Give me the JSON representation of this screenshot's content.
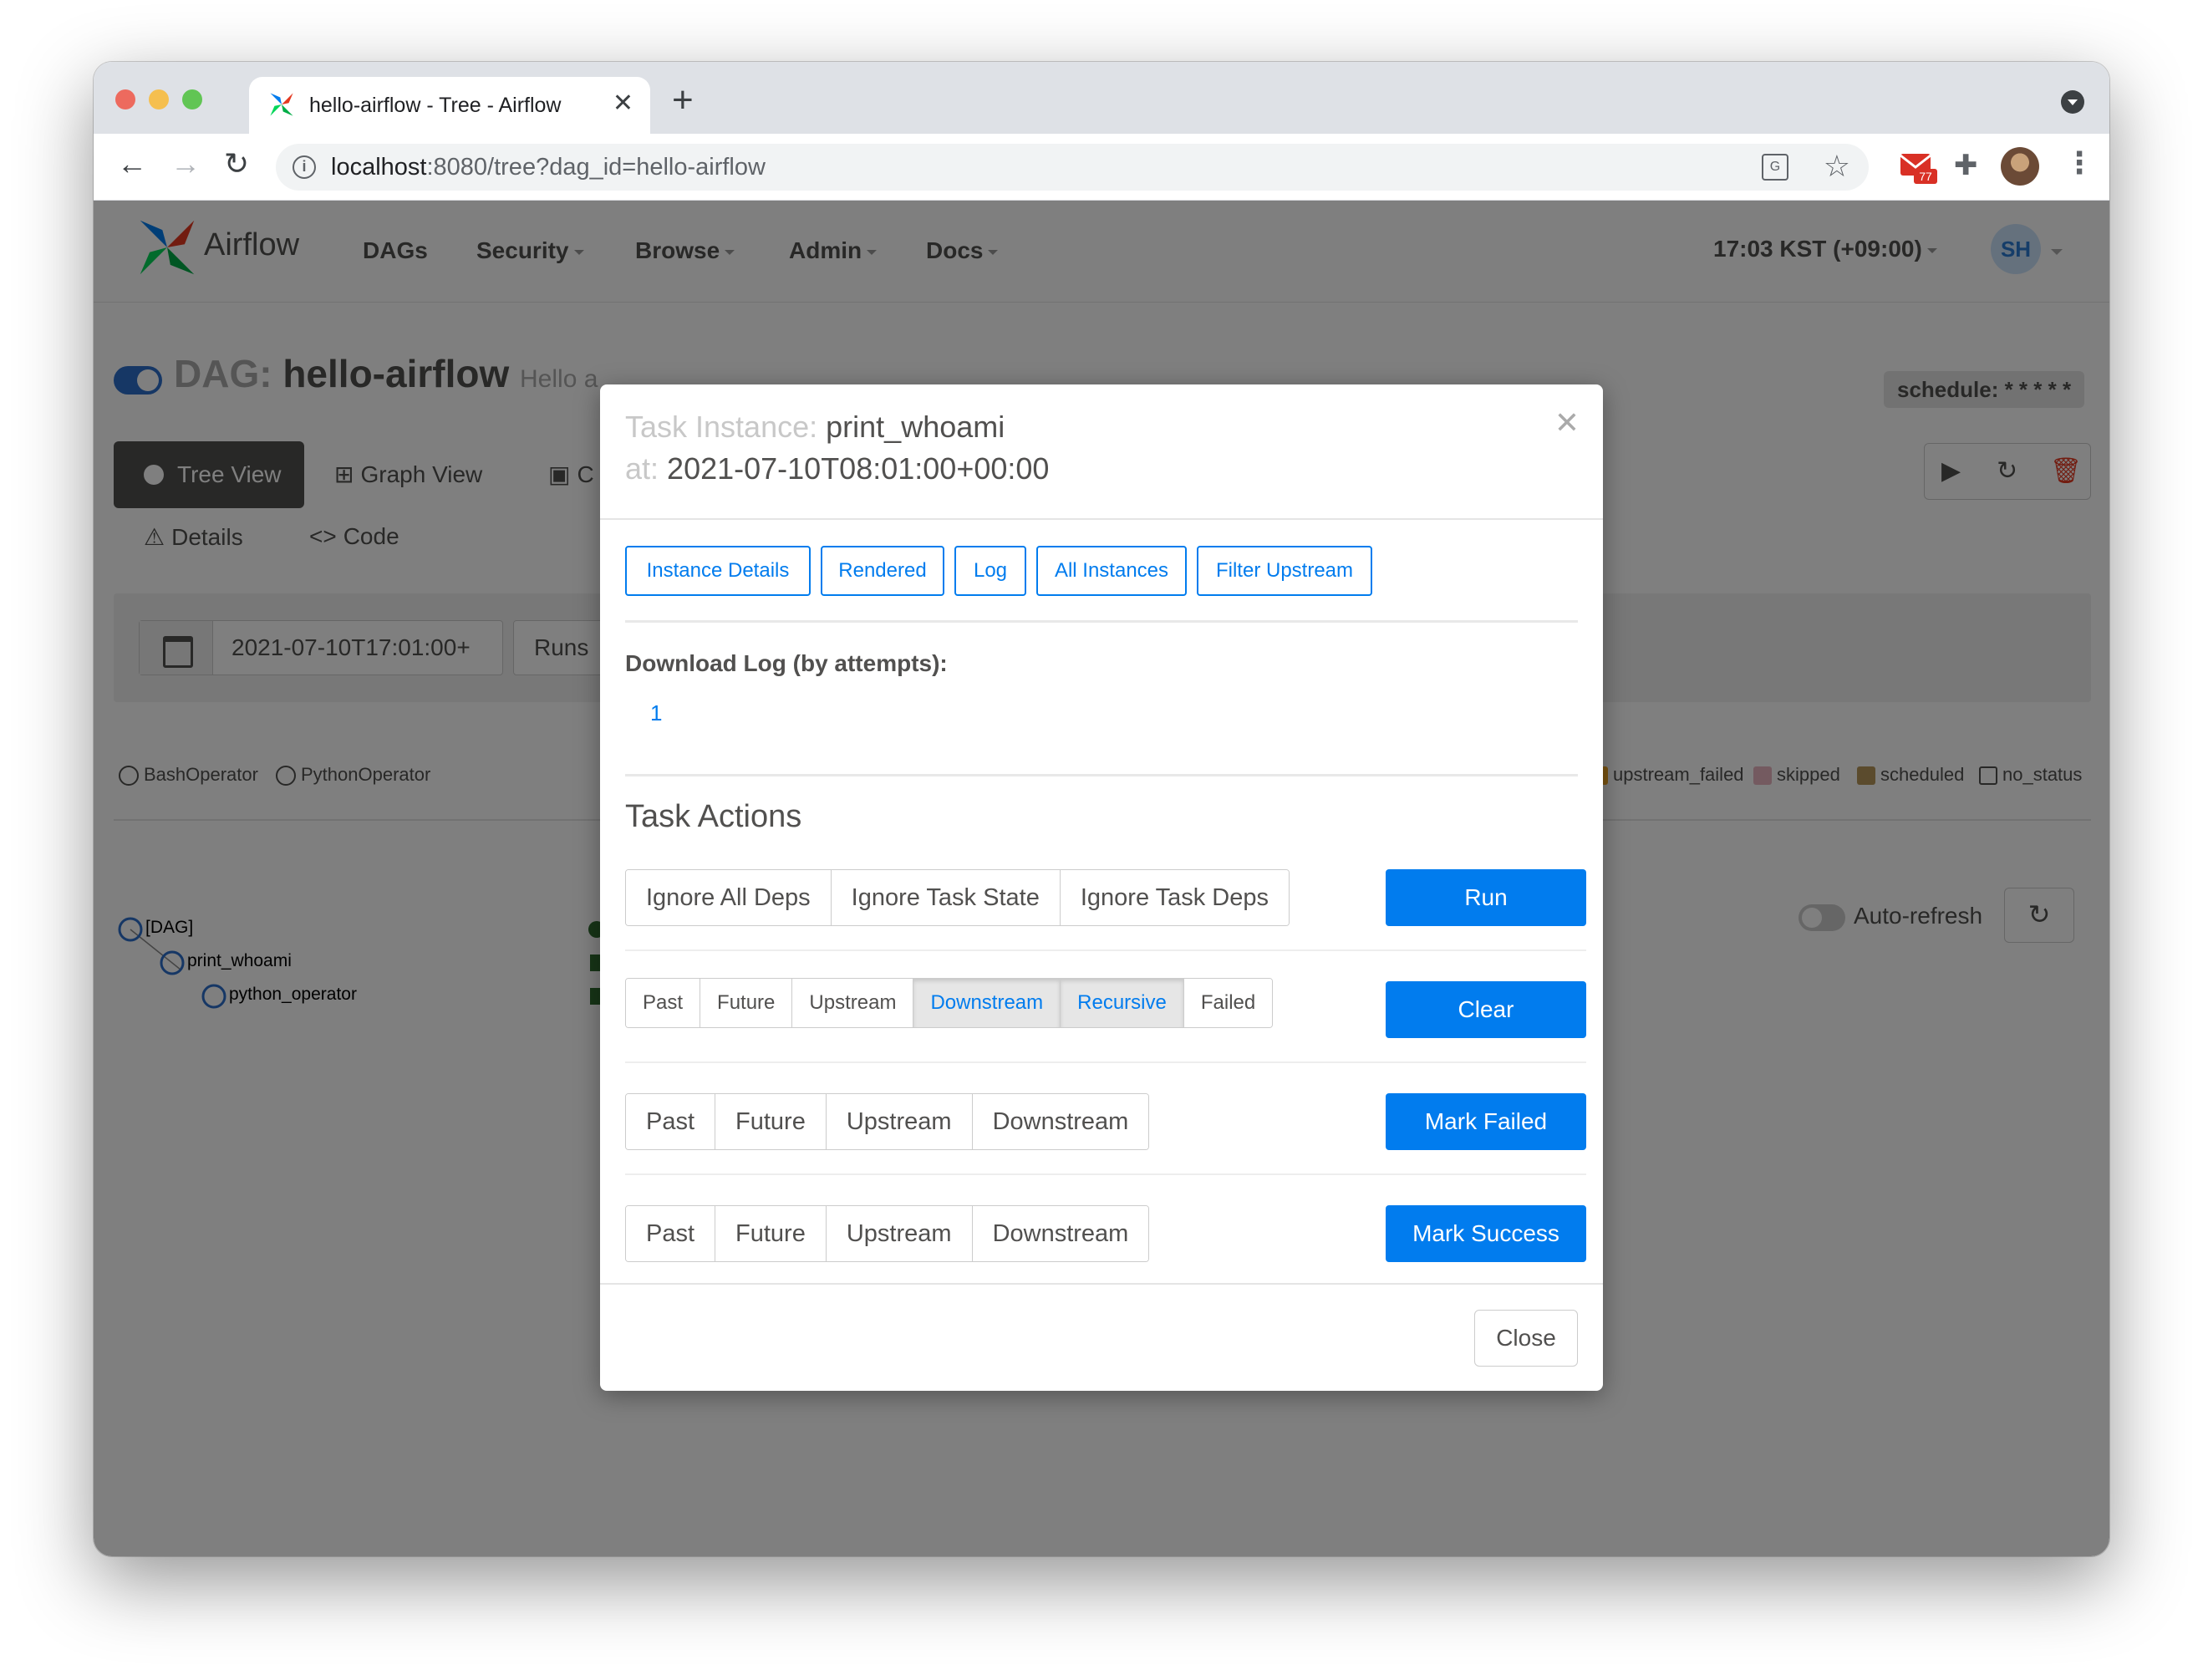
{
  "browser": {
    "tab_title": "hello-airflow - Tree - Airflow",
    "url_host": "localhost",
    "url_rest": ":8080/tree?dag_id=hello-airflow",
    "mail_badge": "77"
  },
  "navbar": {
    "brand": "Airflow",
    "items": [
      "DAGs",
      "Security",
      "Browse",
      "Admin",
      "Docs"
    ],
    "clock": "17:03 KST (+09:00)",
    "user_initials": "SH"
  },
  "dag": {
    "title_prefix": "DAG:",
    "name": "hello-airflow",
    "description": "Hello a",
    "schedule": "schedule: * * * * *",
    "views": [
      "Tree View",
      "Graph View",
      "C"
    ],
    "sub_views": [
      "Details",
      "Code"
    ],
    "base_date": "2021-07-10T17:01:00+",
    "runs_label": "Runs",
    "operators": [
      "BashOperator",
      "PythonOperator"
    ],
    "states": [
      "upstream_failed",
      "skipped",
      "scheduled",
      "no_status"
    ],
    "auto_refresh": "Auto-refresh",
    "tree_nodes": [
      "[DAG]",
      "print_whoami",
      "python_operator"
    ]
  },
  "colors": {
    "primary": "#017cee",
    "upstream_failed": "#f5a623",
    "skipped": "#e8b4c0",
    "scheduled": "#b7975b",
    "success": "#008000"
  },
  "modal": {
    "label_task": "Task Instance:",
    "task_id": "print_whoami",
    "label_at": "at:",
    "execution_date": "2021-07-10T08:01:00+00:00",
    "nav_buttons": [
      "Instance Details",
      "Rendered",
      "Log",
      "All Instances",
      "Filter Upstream"
    ],
    "download_title": "Download Log (by attempts):",
    "attempt": "1",
    "actions_title": "Task Actions",
    "run_options": [
      "Ignore All Deps",
      "Ignore Task State",
      "Ignore Task Deps"
    ],
    "run_label": "Run",
    "clear_options": [
      "Past",
      "Future",
      "Upstream",
      "Downstream",
      "Recursive",
      "Failed"
    ],
    "clear_label": "Clear",
    "failed_options": [
      "Past",
      "Future",
      "Upstream",
      "Downstream"
    ],
    "mark_failed_label": "Mark Failed",
    "success_options": [
      "Past",
      "Future",
      "Upstream",
      "Downstream"
    ],
    "mark_success_label": "Mark Success",
    "close_label": "Close"
  }
}
